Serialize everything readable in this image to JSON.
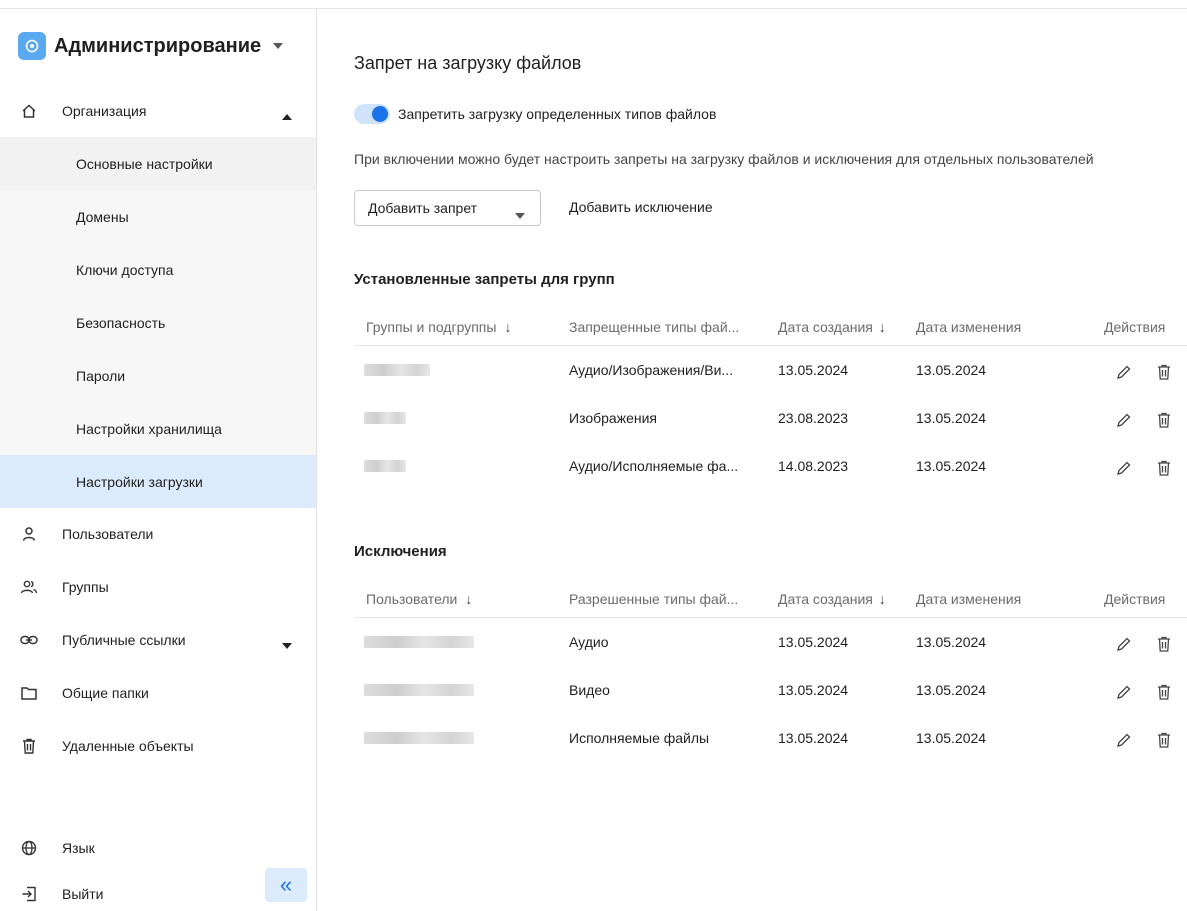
{
  "app": {
    "title": "Администрирование"
  },
  "sidebar": {
    "organization": {
      "label": "Организация"
    },
    "sub_items": [
      {
        "label": "Основные настройки"
      },
      {
        "label": "Домены"
      },
      {
        "label": "Ключи доступа"
      },
      {
        "label": "Безопасность"
      },
      {
        "label": "Пароли"
      },
      {
        "label": "Настройки хранилища"
      },
      {
        "label": "Настройки загрузки"
      }
    ],
    "items": [
      {
        "label": "Пользователи",
        "icon": "user-icon"
      },
      {
        "label": "Группы",
        "icon": "group-icon"
      },
      {
        "label": "Публичные ссылки",
        "icon": "link-icon"
      },
      {
        "label": "Общие папки",
        "icon": "folder-icon"
      },
      {
        "label": "Удаленные объекты",
        "icon": "trash-icon"
      }
    ],
    "footer": [
      {
        "label": "Язык",
        "icon": "globe-icon"
      },
      {
        "label": "Выйти",
        "icon": "logout-icon"
      }
    ],
    "collapse_symbol": "«"
  },
  "main": {
    "title": "Запрет на загрузку файлов",
    "toggle": {
      "label": "Запретить загрузку определенных типов файлов",
      "on": true
    },
    "hint": "При включении можно будет настроить запреты на загрузку файлов и исключения для отдельных пользователей",
    "add_ban_label": "Добавить запрет",
    "add_exception_label": "Добавить исключение",
    "groups_section": {
      "title": "Установленные запреты для групп",
      "columns": [
        "Группы и подгруппы",
        "Запрещенные типы фай...",
        "Дата создания",
        "Дата изменения",
        "Действия"
      ],
      "rows": [
        {
          "types": "Аудио/Изображения/Ви...",
          "created": "13.05.2024",
          "modified": "13.05.2024"
        },
        {
          "types": "Изображения",
          "created": "23.08.2023",
          "modified": "13.05.2024"
        },
        {
          "types": "Аудио/Исполняемые фа...",
          "created": "14.08.2023",
          "modified": "13.05.2024"
        }
      ]
    },
    "exceptions_section": {
      "title": "Исключения",
      "columns": [
        "Пользователи",
        "Разрешенные типы фай...",
        "Дата создания",
        "Дата изменения",
        "Действия"
      ],
      "rows": [
        {
          "types": "Аудио",
          "created": "13.05.2024",
          "modified": "13.05.2024"
        },
        {
          "types": "Видео",
          "created": "13.05.2024",
          "modified": "13.05.2024"
        },
        {
          "types": "Исполняемые файлы",
          "created": "13.05.2024",
          "modified": "13.05.2024"
        }
      ]
    },
    "sort_symbol": "↓"
  },
  "colors": {
    "accent": "#1a73e8",
    "active_bg": "#dcebfb",
    "sub_bg": "#f2f2f2"
  }
}
